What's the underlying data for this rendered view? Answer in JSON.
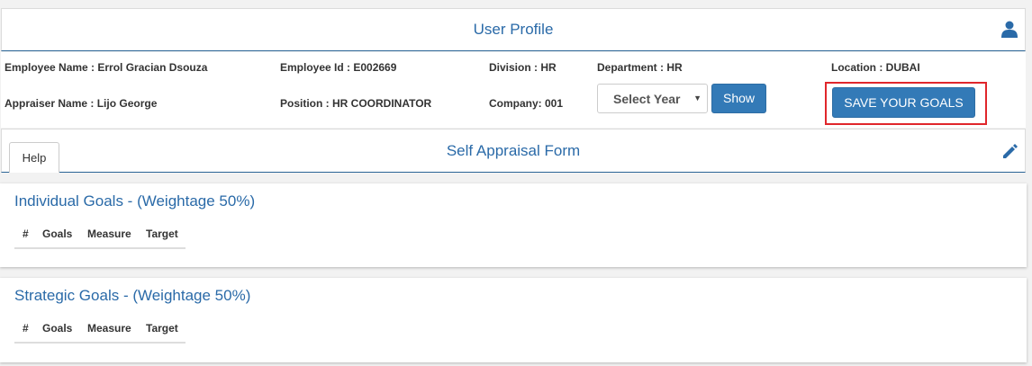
{
  "profile": {
    "title": "User Profile",
    "icon": "user-icon"
  },
  "employee": {
    "name": "Employee Name : Errol Gracian Dsouza",
    "id": "Employee Id : E002669",
    "division": "Division : HR",
    "department": "Department : HR",
    "location": "Location : DUBAI",
    "appraiser": "Appraiser Name : Lijo George",
    "position": "Position : HR COORDINATOR",
    "company": "Company: 001"
  },
  "controls": {
    "year_select": "Select Year",
    "show_label": "Show",
    "save_label": "SAVE YOUR GOALS"
  },
  "appraisal": {
    "help_tab": "Help",
    "title": "Self Appraisal Form",
    "edit_icon": "pencil-icon"
  },
  "sections": [
    {
      "title": "Individual Goals - (Weightage 50%)",
      "columns": [
        "#",
        "Goals",
        "Measure",
        "Target"
      ]
    },
    {
      "title": "Strategic Goals - (Weightage 50%)",
      "columns": [
        "#",
        "Goals",
        "Measure",
        "Target"
      ]
    }
  ],
  "colors": {
    "accent": "#337ab7",
    "title_blue": "#2a6aa8",
    "highlight": "#e0262b"
  }
}
